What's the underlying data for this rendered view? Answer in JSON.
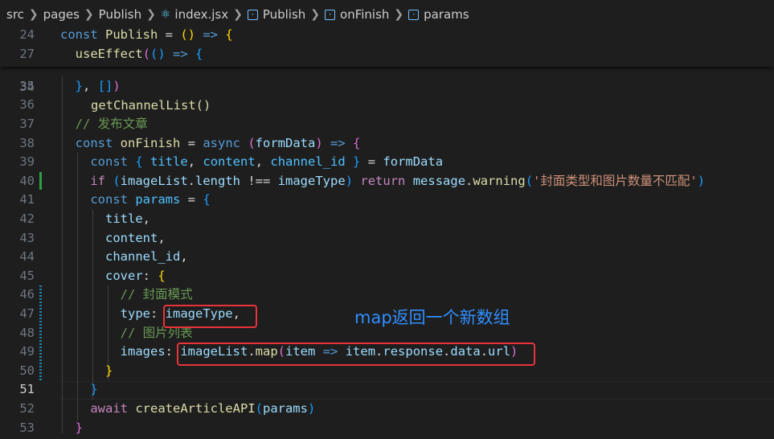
{
  "breadcrumb": {
    "items": [
      {
        "label": "src"
      },
      {
        "label": "pages"
      },
      {
        "label": "Publish"
      },
      {
        "label": "index.jsx",
        "icon": "react-icon"
      },
      {
        "label": "Publish",
        "icon": "symbol-icon"
      },
      {
        "label": "onFinish",
        "icon": "symbol-icon"
      },
      {
        "label": "params",
        "icon": "symbol-icon"
      }
    ]
  },
  "editor": {
    "active_line": "51",
    "lines": [
      {
        "n": "24",
        "tokens": [
          [
            "kw",
            "const "
          ],
          [
            "fn",
            "Publish"
          ],
          [
            "p",
            " = "
          ],
          [
            "b1",
            "()"
          ],
          [
            "p",
            " "
          ],
          [
            "kw",
            "=>"
          ],
          [
            "p",
            " "
          ],
          [
            "b1",
            "{"
          ]
        ]
      },
      {
        "n": "27",
        "tokens": [
          [
            "p",
            "  "
          ],
          [
            "fn",
            "useEffect"
          ],
          [
            "b2",
            "("
          ],
          [
            "b3",
            "()"
          ],
          [
            "p",
            " "
          ],
          [
            "kw",
            "=>"
          ],
          [
            "p",
            " "
          ],
          [
            "b3",
            "{"
          ]
        ]
      },
      {
        "n": "35",
        "tokens": [
          [
            "p",
            "  "
          ],
          [
            "b3",
            "}"
          ],
          [
            "p",
            ", "
          ],
          [
            "b3",
            "[]"
          ],
          [
            "b2",
            ")"
          ]
        ]
      },
      {
        "n": "36",
        "tokens": []
      },
      {
        "n": "37",
        "tokens": [
          [
            "p",
            "  "
          ],
          [
            "com",
            "// 发布文章"
          ]
        ]
      },
      {
        "n": "38",
        "tokens": [
          [
            "p",
            "  "
          ],
          [
            "kw",
            "const "
          ],
          [
            "fn",
            "onFinish"
          ],
          [
            "p",
            " = "
          ],
          [
            "kw",
            "async "
          ],
          [
            "b2",
            "("
          ],
          [
            "var",
            "formData"
          ],
          [
            "b2",
            ")"
          ],
          [
            "p",
            " "
          ],
          [
            "kw",
            "=>"
          ],
          [
            "p",
            " "
          ],
          [
            "b2",
            "{"
          ]
        ]
      },
      {
        "n": "39",
        "tokens": [
          [
            "p",
            "    "
          ],
          [
            "kw",
            "const "
          ],
          [
            "b3",
            "{"
          ],
          [
            "p",
            " "
          ],
          [
            "const",
            "title"
          ],
          [
            "p",
            ", "
          ],
          [
            "const",
            "content"
          ],
          [
            "p",
            ", "
          ],
          [
            "const",
            "channel_id"
          ],
          [
            "p",
            " "
          ],
          [
            "b3",
            "}"
          ],
          [
            "p",
            " = "
          ],
          [
            "var",
            "formData"
          ]
        ]
      },
      {
        "n": "40",
        "tokens": [
          [
            "p",
            "    "
          ],
          [
            "ctrl",
            "if "
          ],
          [
            "b3",
            "("
          ],
          [
            "var",
            "imageList"
          ],
          [
            "p",
            "."
          ],
          [
            "var",
            "length"
          ],
          [
            "p",
            " !== "
          ],
          [
            "var",
            "imageType"
          ],
          [
            "b3",
            ")"
          ],
          [
            "p",
            " "
          ],
          [
            "ctrl",
            "return "
          ],
          [
            "var",
            "message"
          ],
          [
            "p",
            "."
          ],
          [
            "fn",
            "warning"
          ],
          [
            "b3",
            "("
          ],
          [
            "str",
            "'封面类型和图片数量不匹配'"
          ],
          [
            "b3",
            ")"
          ]
        ]
      },
      {
        "n": "41",
        "tokens": [
          [
            "p",
            "    "
          ],
          [
            "kw",
            "const "
          ],
          [
            "const",
            "params"
          ],
          [
            "p",
            " = "
          ],
          [
            "b3",
            "{"
          ]
        ]
      },
      {
        "n": "42",
        "tokens": [
          [
            "p",
            "      "
          ],
          [
            "var",
            "title"
          ],
          [
            "p",
            ","
          ]
        ]
      },
      {
        "n": "43",
        "tokens": [
          [
            "p",
            "      "
          ],
          [
            "var",
            "content"
          ],
          [
            "p",
            ","
          ]
        ]
      },
      {
        "n": "44",
        "tokens": [
          [
            "p",
            "      "
          ],
          [
            "var",
            "channel_id"
          ],
          [
            "p",
            ","
          ]
        ]
      },
      {
        "n": "45",
        "tokens": [
          [
            "p",
            "      "
          ],
          [
            "var",
            "cover"
          ],
          [
            "p",
            ": "
          ],
          [
            "b1",
            "{"
          ]
        ]
      },
      {
        "n": "46",
        "tokens": [
          [
            "p",
            "        "
          ],
          [
            "com",
            "// 封面模式"
          ]
        ]
      },
      {
        "n": "47",
        "tokens": [
          [
            "p",
            "        "
          ],
          [
            "var",
            "type"
          ],
          [
            "p",
            ": "
          ],
          [
            "var",
            "imageType"
          ],
          [
            "p",
            ","
          ]
        ]
      },
      {
        "n": "48",
        "tokens": [
          [
            "p",
            "        "
          ],
          [
            "com",
            "// 图片列表"
          ]
        ]
      },
      {
        "n": "49",
        "tokens": [
          [
            "p",
            "        "
          ],
          [
            "var",
            "images"
          ],
          [
            "p",
            ": "
          ],
          [
            "var",
            "imageList"
          ],
          [
            "p",
            "."
          ],
          [
            "fn",
            "map"
          ],
          [
            "b2",
            "("
          ],
          [
            "var",
            "item"
          ],
          [
            "p",
            " "
          ],
          [
            "kw",
            "=>"
          ],
          [
            "p",
            " "
          ],
          [
            "var",
            "item"
          ],
          [
            "p",
            "."
          ],
          [
            "var",
            "response"
          ],
          [
            "p",
            "."
          ],
          [
            "var",
            "data"
          ],
          [
            "p",
            "."
          ],
          [
            "var",
            "url"
          ],
          [
            "b2",
            ")"
          ]
        ]
      },
      {
        "n": "50",
        "tokens": [
          [
            "p",
            "      "
          ],
          [
            "b1",
            "}"
          ]
        ]
      },
      {
        "n": "51",
        "tokens": [
          [
            "p",
            "    "
          ],
          [
            "b3",
            "}"
          ]
        ]
      },
      {
        "n": "52",
        "tokens": [
          [
            "p",
            "    "
          ],
          [
            "ctrl",
            "await "
          ],
          [
            "fn",
            "createArticleAPI"
          ],
          [
            "b3",
            "("
          ],
          [
            "var",
            "params"
          ],
          [
            "b3",
            ")"
          ]
        ]
      },
      {
        "n": "53",
        "tokens": [
          [
            "p",
            "  "
          ],
          [
            "b2",
            "}"
          ]
        ]
      }
    ],
    "hidden_line": {
      "n": "34",
      "text": "getChannelList()"
    }
  },
  "annotation": {
    "text": "map返回一个新数组",
    "color": "#2f8fff"
  },
  "colors": {
    "background": "#1e1e1e",
    "highlight_box": "#e8333a",
    "git_modified": "#2ea043",
    "git_changed": "#1b81a8"
  }
}
